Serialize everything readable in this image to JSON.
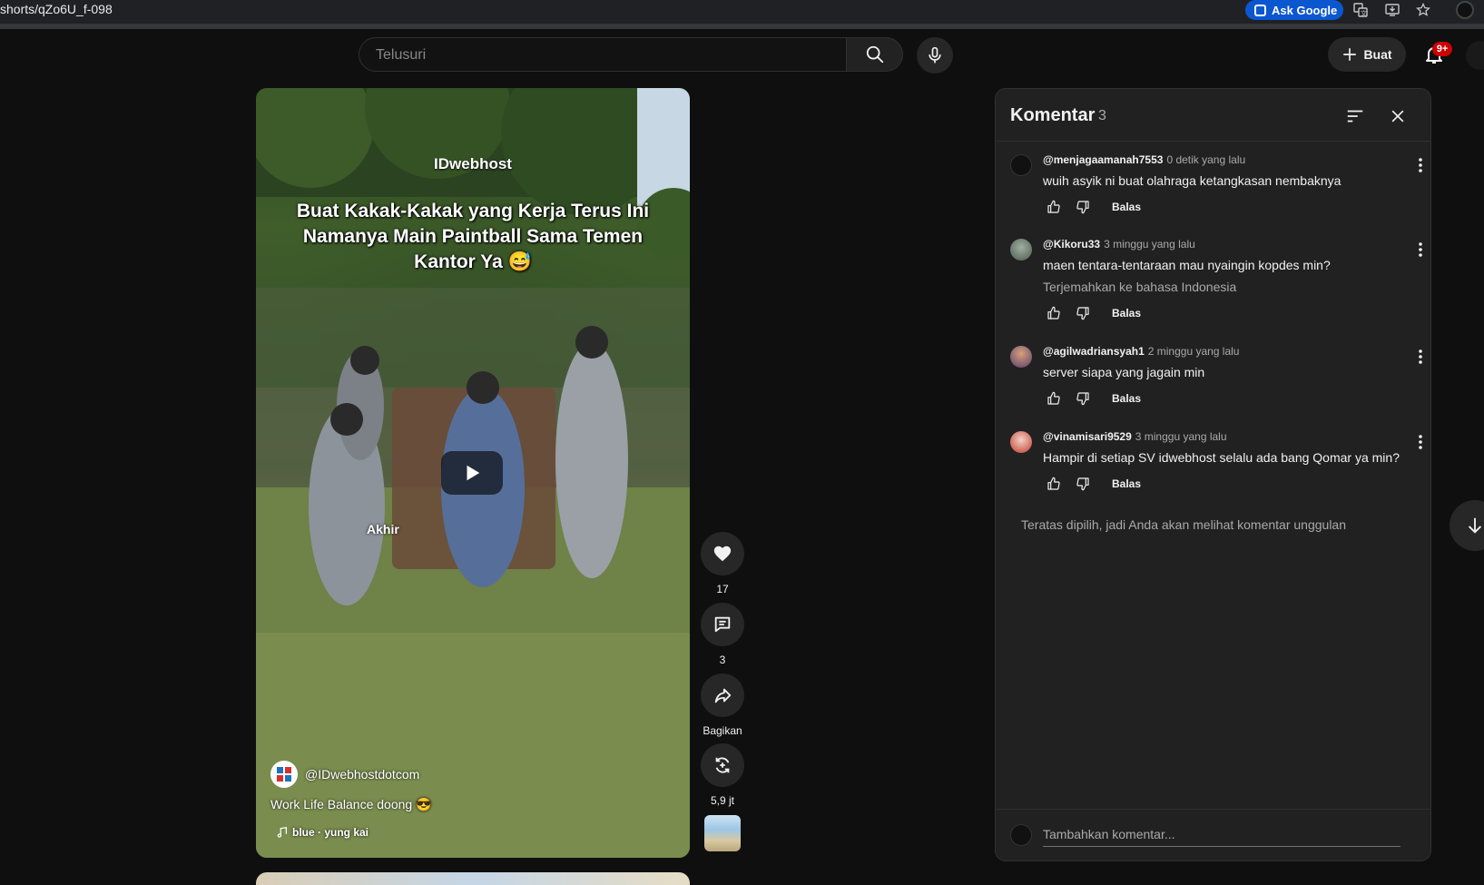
{
  "browser": {
    "url": "shorts/qZo6U_f-098",
    "ask_google": "Ask Google"
  },
  "topbar": {
    "search_placeholder": "Telusuri",
    "create_label": "Buat",
    "notification_count": "9+"
  },
  "video": {
    "brand": "IDwebhost",
    "overlay_title": "Buat Kakak-Kakak yang Kerja Terus Ini Namanya Main Paintball Sama Temen Kantor Ya 😅",
    "overlay_label": "Akhir",
    "channel": "@IDwebhostdotcom",
    "caption": "Work Life Balance doong 😎",
    "music": "blue · yung kai"
  },
  "actions": {
    "likes": "17",
    "comments": "3",
    "share": "Bagikan",
    "remix": "5,9 jt"
  },
  "comments": {
    "title": "Komentar",
    "count": "3",
    "items": [
      {
        "author": "@menjagaamanah7553",
        "time": "0 detik yang lalu",
        "text": "wuih asyik ni buat olahraga ketangkasan nembaknya",
        "reply": "Balas"
      },
      {
        "author": "@Kikoru33",
        "time": "3 minggu yang lalu",
        "text": "maen tentara-tentaraan mau nyaingin kopdes min?",
        "translate": "Terjemahkan ke bahasa Indonesia",
        "reply": "Balas"
      },
      {
        "author": "@agilwadriansyah1",
        "time": "2 minggu yang lalu",
        "text": "server siapa yang jagain min",
        "reply": "Balas"
      },
      {
        "author": "@vinamisari9529",
        "time": "3 minggu yang lalu",
        "text": "Hampir di setiap SV idwebhost selalu ada bang Qomar ya min?",
        "reply": "Balas"
      }
    ],
    "top_note": "Teratas dipilih, jadi Anda akan melihat komentar unggulan",
    "add_placeholder": "Tambahkan komentar..."
  },
  "colors": {
    "background": "#0f0f0f",
    "panel": "#212121",
    "chip": "#272727",
    "notification_badge": "#cc0000",
    "ask_google": "#0b57d0"
  }
}
